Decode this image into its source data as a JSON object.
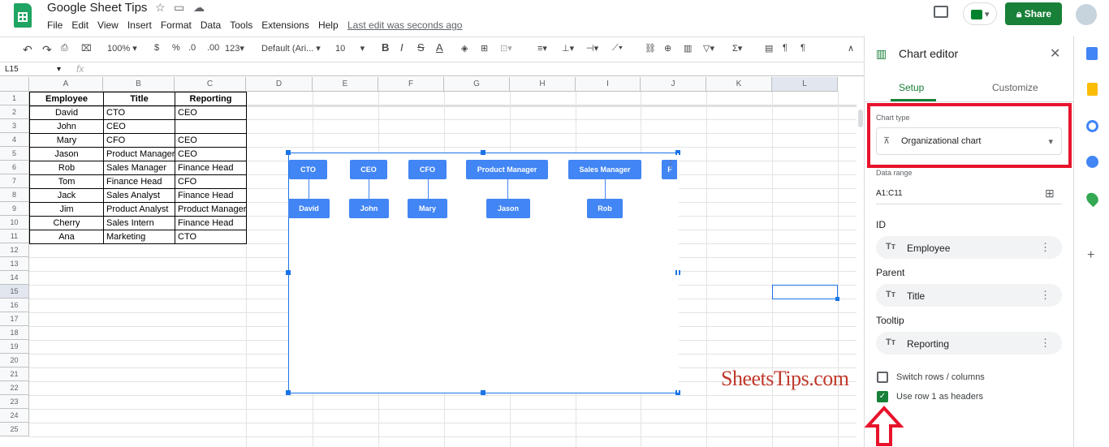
{
  "app": {
    "title": "Google Sheet Tips",
    "last_edit": "Last edit was seconds ago",
    "share_label": "Share",
    "menus": [
      "File",
      "Edit",
      "View",
      "Insert",
      "Format",
      "Data",
      "Tools",
      "Extensions",
      "Help"
    ]
  },
  "toolbar": {
    "zoom": "100%",
    "currency": "$",
    "percent": "%",
    "dec_less": ".0",
    "dec_more": ".00",
    "number_format": "123",
    "font": "Default (Ari...",
    "font_size": "10",
    "fx": "fx",
    "name_box": "L15"
  },
  "grid": {
    "columns": [
      "A",
      "B",
      "C",
      "D",
      "E",
      "F",
      "G",
      "H",
      "I",
      "J",
      "K",
      "L"
    ],
    "rows": [
      "1",
      "2",
      "3",
      "4",
      "5",
      "6",
      "7",
      "8",
      "9",
      "10",
      "11",
      "12",
      "13",
      "14",
      "15",
      "16",
      "17",
      "18",
      "19",
      "20",
      "21",
      "22",
      "23",
      "24",
      "25"
    ],
    "headers": [
      "Employee",
      "Title",
      "Reporting"
    ],
    "data": [
      [
        "David",
        "CTO",
        "CEO"
      ],
      [
        "John",
        "CEO",
        ""
      ],
      [
        "Mary",
        "CFO",
        "CEO"
      ],
      [
        "Jason",
        "Product Manager",
        "CEO"
      ],
      [
        "Rob",
        "Sales Manager",
        "Finance Head"
      ],
      [
        "Tom",
        "Finance Head",
        "CFO"
      ],
      [
        "Jack",
        "Sales Analyst",
        "Finance Head"
      ],
      [
        "Jim",
        "Product Analyst",
        "Product Manager"
      ],
      [
        "Cherry",
        "Sales Intern",
        "Finance Head"
      ],
      [
        "Ana",
        "Marketing",
        "CTO"
      ]
    ]
  },
  "chart": {
    "top_nodes": [
      "CTO",
      "CEO",
      "CFO",
      "Product Manager",
      "Sales Manager",
      "F"
    ],
    "child_nodes": [
      "David",
      "John",
      "Mary",
      "Jason",
      "Rob"
    ],
    "node_color": "#4285f4"
  },
  "editor": {
    "title": "Chart editor",
    "tabs": [
      "Setup",
      "Customize"
    ],
    "chart_type_label": "Chart type",
    "chart_type_value": "Organizational chart",
    "data_range_label": "Data range",
    "data_range_value": "A1:C11",
    "id_label": "ID",
    "id_value": "Employee",
    "parent_label": "Parent",
    "parent_value": "Title",
    "tooltip_label": "Tooltip",
    "tooltip_value": "Reporting",
    "switch_label": "Switch rows / columns",
    "headers_label": "Use row 1 as headers",
    "tt_glyph": "Tт"
  },
  "watermark": "SheetsTips.com",
  "colors": {
    "accent": "#1a73e8",
    "highlight_box": "#e8132b",
    "share": "#188038"
  }
}
